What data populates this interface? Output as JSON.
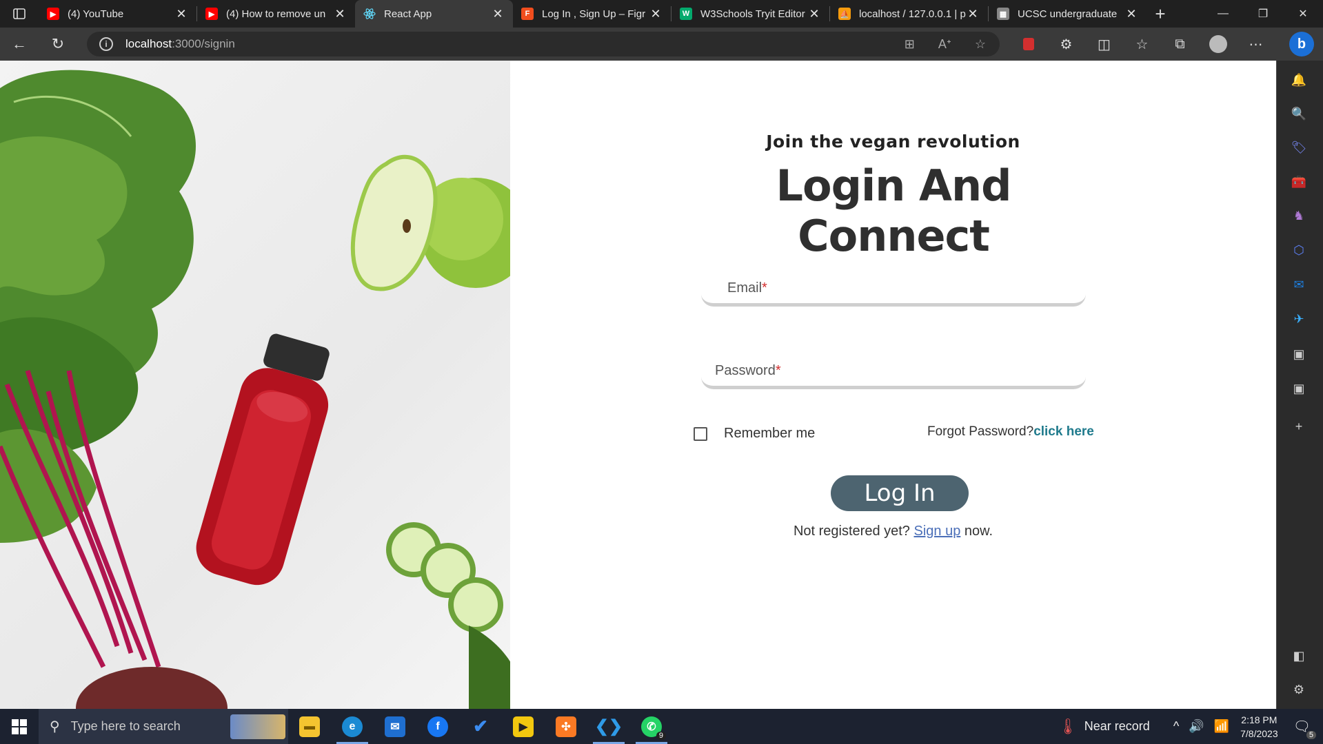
{
  "browser": {
    "tabs": [
      {
        "title": "(4) YouTube",
        "favicon": "youtube-icon",
        "color": "#ff0000",
        "active": false
      },
      {
        "title": "(4) How to remove un",
        "favicon": "youtube-icon",
        "color": "#ff0000",
        "active": false
      },
      {
        "title": "React App",
        "favicon": "react-icon",
        "color": "#61dafb",
        "active": true
      },
      {
        "title": "Log In , Sign Up – Figr",
        "favicon": "figma-icon",
        "color": "#f24e1e",
        "active": false
      },
      {
        "title": "W3Schools Tryit Editor",
        "favicon": "w3schools-icon",
        "color": "#04aa6d",
        "active": false
      },
      {
        "title": "localhost / 127.0.0.1 | p",
        "favicon": "phpmyadmin-icon",
        "color": "#f89c0e",
        "active": false
      },
      {
        "title": "UCSC undergraduate",
        "favicon": "page-icon",
        "color": "#888888",
        "active": false
      }
    ],
    "url_host": "localhost",
    "url_path": ":3000/signin"
  },
  "page": {
    "tagline": "Join the vegan revolution",
    "title": "Login And Connect",
    "email_label": "Email",
    "password_label": "Password",
    "required_mark": "*",
    "remember_label": "Remember me",
    "forgot_text": "Forgot Password?",
    "forgot_link": "click here",
    "login_button": "Log In",
    "signup_prefix": "Not registered yet? ",
    "signup_link": "Sign up",
    "signup_suffix": " now.",
    "accent_color": "#4d6470",
    "link_color": "#1f7a8c"
  },
  "taskbar": {
    "search_placeholder": "Type here to search",
    "weather": "Near record",
    "time": "2:18 PM",
    "date": "7/8/2023",
    "whatsapp_badge": "9",
    "notifications_badge": "5"
  }
}
